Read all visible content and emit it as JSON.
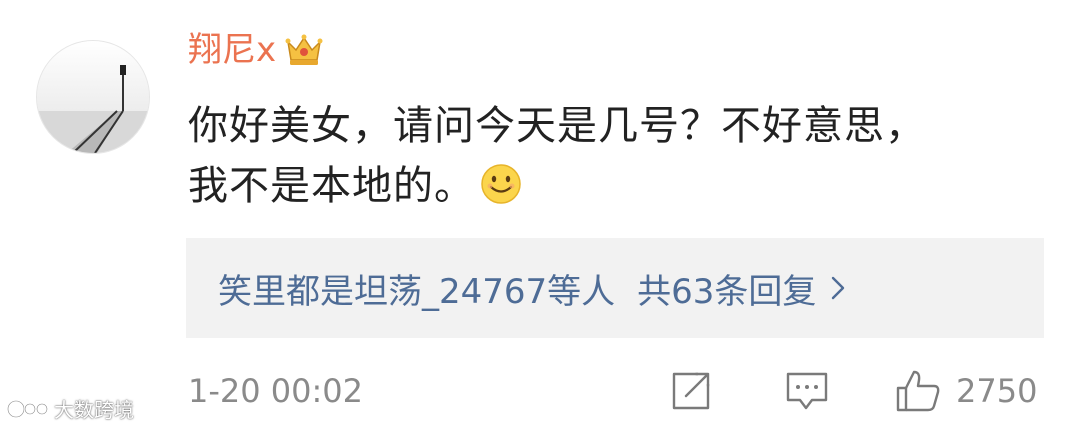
{
  "comment": {
    "username": "翔尼x",
    "text_line1": "你好美女，请问今天是几号？不好意思，",
    "text_line2": "我不是本地的。",
    "username_color": "#eb7350",
    "badge_icon": "crown-icon",
    "emoji_icon": "smile-emoji-icon"
  },
  "replies": {
    "preview_user": "笑里都是坦荡_24767等人",
    "total_label": "共63条回复",
    "link_color": "#4e6c96"
  },
  "footer": {
    "timestamp": "1-20 00:02",
    "like_count": "2750"
  },
  "watermark": {
    "text": "大数跨境"
  }
}
